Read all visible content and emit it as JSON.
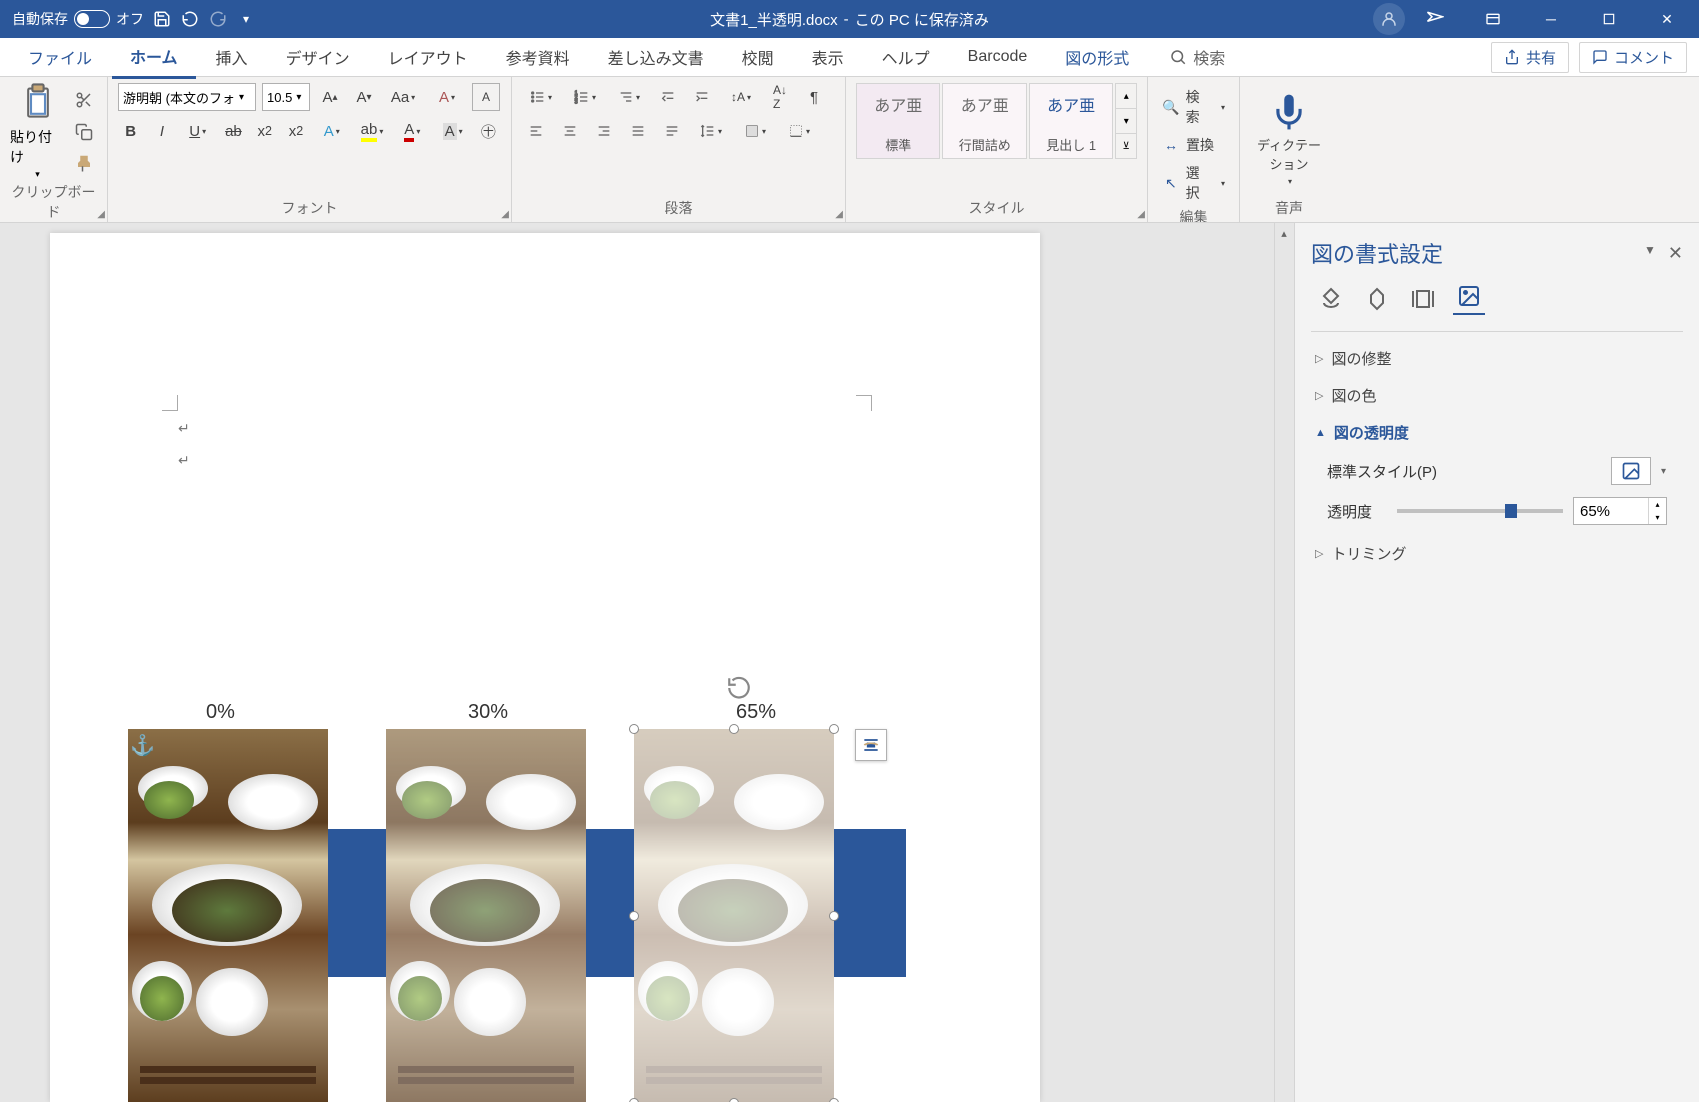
{
  "titlebar": {
    "autosave_label": "自動保存",
    "autosave_state": "オフ",
    "doc_title": "文書1_半透明.docx",
    "save_location": "この PC に保存済み"
  },
  "tabs": {
    "file": "ファイル",
    "home": "ホーム",
    "insert": "挿入",
    "design": "デザイン",
    "layout": "レイアウト",
    "references": "参考資料",
    "mailings": "差し込み文書",
    "review": "校閲",
    "view": "表示",
    "help": "ヘルプ",
    "barcode": "Barcode",
    "picture_format": "図の形式",
    "search": "検索",
    "share": "共有",
    "comment": "コメント"
  },
  "ribbon": {
    "clipboard": {
      "paste": "貼り付け",
      "group": "クリップボード"
    },
    "font": {
      "name": "游明朝 (本文のフォ",
      "size": "10.5",
      "group": "フォント"
    },
    "para": {
      "group": "段落"
    },
    "styles": {
      "preview": "あア亜",
      "s1": "標準",
      "s2": "行間詰め",
      "s3": "見出し 1",
      "group": "スタイル"
    },
    "editing": {
      "find": "検索",
      "replace": "置換",
      "select": "選択",
      "group": "編集"
    },
    "voice": {
      "dictate": "ディクテーション",
      "group": "音声"
    }
  },
  "document": {
    "labels": {
      "l1": "0%",
      "l2": "30%",
      "l3": "65%"
    }
  },
  "panel": {
    "title": "図の書式設定",
    "sections": {
      "correction": "図の修整",
      "color": "図の色",
      "transparency": "図の透明度",
      "crop": "トリミング"
    },
    "transparency": {
      "preset_label": "標準スタイル(P)",
      "slider_label": "透明度",
      "value": "65%",
      "percent": 65
    }
  }
}
